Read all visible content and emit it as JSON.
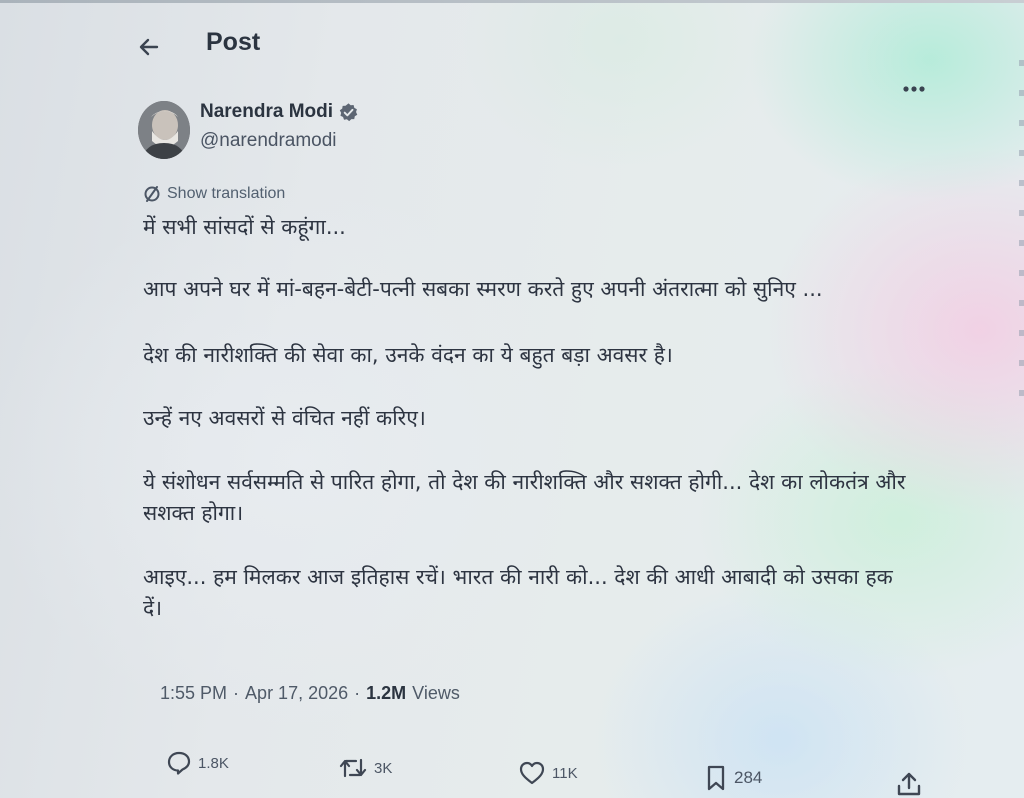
{
  "header": {
    "title": "Post"
  },
  "author": {
    "display_name": "Narendra Modi",
    "handle": "@narendramodi",
    "verified": true
  },
  "tweet": {
    "show_translation": "Show translation",
    "paragraphs": [
      "में सभी सांसदों से कहूंगा...",
      "आप अपने घर में मां-बहन-बेटी-पत्नी सबका स्मरण करते हुए अपनी अंतरात्मा को सुनिए ...",
      "देश की नारीशक्ति की सेवा का, उनके वंदन का ये बहुत बड़ा अवसर है।",
      "उन्हें नए अवसरों से वंचित नहीं करिए।",
      "ये संशोधन सर्वसम्मति से पारित होगा, तो देश की नारीशक्ति और सशक्त होगी... देश का लोकतंत्र और सशक्त होगा।",
      "आइए... हम मिलकर आज इतिहास रचें। भारत की नारी को... देश की आधी आबादी को उसका हक दें।"
    ]
  },
  "meta": {
    "time": "1:55 PM",
    "date": "Apr 17, 2026",
    "separator": "·",
    "views_count": "1.2M",
    "views_label": "Views"
  },
  "actions": {
    "replies": "1.8K",
    "reposts": "3K",
    "likes": "11K",
    "bookmarks": "284"
  },
  "colors": {
    "text": "#2d3441",
    "secondary": "#4f5a68",
    "verified_badge": "#5d6673"
  },
  "icons": {
    "back": "arrow-left-icon",
    "more": "more-horizontal-icon",
    "verified": "verified-badge-icon",
    "translate": "globe-translate-icon",
    "reply": "reply-bubble-icon",
    "repost": "repost-icon",
    "like": "heart-icon",
    "bookmark": "bookmark-icon",
    "share": "share-upload-icon"
  }
}
